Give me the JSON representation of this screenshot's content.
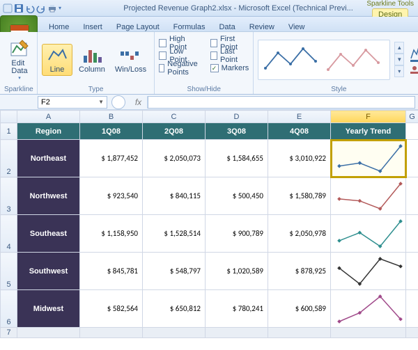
{
  "title": "Projected Revenue Graph2.xlsx - Microsoft Excel (Technical Previ...",
  "context": {
    "group": "Sparkline Tools",
    "tab": "Design"
  },
  "tabs": [
    "Home",
    "Insert",
    "Page Layout",
    "Formulas",
    "Data",
    "Review",
    "View"
  ],
  "ribbon": {
    "sparkline": {
      "label": "Sparkline",
      "edit": "Edit\nData"
    },
    "type": {
      "label": "Type",
      "line": "Line",
      "column": "Column",
      "winloss": "Win/Loss"
    },
    "showhide": {
      "label": "Show/Hide",
      "items": [
        {
          "label": "High Point",
          "checked": false
        },
        {
          "label": "Low Point",
          "checked": false
        },
        {
          "label": "Negative Points",
          "checked": false
        },
        {
          "label": "First Point",
          "checked": false
        },
        {
          "label": "Last Point",
          "checked": false
        },
        {
          "label": "Markers",
          "checked": true
        }
      ]
    },
    "style": {
      "label": "Style"
    }
  },
  "namebox": "F2",
  "fx_label": "fx",
  "headers": [
    "A",
    "B",
    "C",
    "D",
    "E",
    "F",
    "G"
  ],
  "col_heads": {
    "region": "Region",
    "q1": "1Q08",
    "q2": "2Q08",
    "q3": "3Q08",
    "q4": "4Q08",
    "trend": "Yearly Trend"
  },
  "rows": [
    {
      "n": "2",
      "region": "Northeast",
      "v": [
        "$ 1,877,452",
        "$ 2,050,073",
        "$ 1,584,655",
        "$ 3,010,922"
      ],
      "color": "#3b6fa6",
      "pts": [
        1877452,
        2050073,
        1584655,
        3010922
      ]
    },
    {
      "n": "3",
      "region": "Northwest",
      "v": [
        "$    923,540",
        "$    840,115",
        "$    500,450",
        "$ 1,580,789"
      ],
      "color": "#b35a5a",
      "pts": [
        923540,
        840115,
        500450,
        1580789
      ]
    },
    {
      "n": "4",
      "region": "Southeast",
      "v": [
        "$ 1,158,950",
        "$ 1,528,514",
        "$    900,789",
        "$ 2,050,978"
      ],
      "color": "#2f8f8f",
      "pts": [
        1158950,
        1528514,
        900789,
        2050978
      ]
    },
    {
      "n": "5",
      "region": "Southwest",
      "v": [
        "$    845,781",
        "$    548,797",
        "$ 1,020,589",
        "$    878,925"
      ],
      "color": "#333333",
      "pts": [
        845781,
        548797,
        1020589,
        878925
      ]
    },
    {
      "n": "6",
      "region": "Midwest",
      "v": [
        "$    582,564",
        "$    650,812",
        "$    780,241",
        "$    600,589"
      ],
      "color": "#a04a8a",
      "pts": [
        582564,
        650812,
        780241,
        600589
      ]
    }
  ],
  "chart_data": [
    {
      "type": "line",
      "title": "Northeast Yearly Trend",
      "categories": [
        "1Q08",
        "2Q08",
        "3Q08",
        "4Q08"
      ],
      "values": [
        1877452,
        2050073,
        1584655,
        3010922
      ]
    },
    {
      "type": "line",
      "title": "Northwest Yearly Trend",
      "categories": [
        "1Q08",
        "2Q08",
        "3Q08",
        "4Q08"
      ],
      "values": [
        923540,
        840115,
        500450,
        1580789
      ]
    },
    {
      "type": "line",
      "title": "Southeast Yearly Trend",
      "categories": [
        "1Q08",
        "2Q08",
        "3Q08",
        "4Q08"
      ],
      "values": [
        1158950,
        1528514,
        900789,
        2050978
      ]
    },
    {
      "type": "line",
      "title": "Southwest Yearly Trend",
      "categories": [
        "1Q08",
        "2Q08",
        "3Q08",
        "4Q08"
      ],
      "values": [
        845781,
        548797,
        1020589,
        878925
      ]
    },
    {
      "type": "line",
      "title": "Midwest Yearly Trend",
      "categories": [
        "1Q08",
        "2Q08",
        "3Q08",
        "4Q08"
      ],
      "values": [
        582564,
        650812,
        780241,
        600589
      ]
    }
  ]
}
